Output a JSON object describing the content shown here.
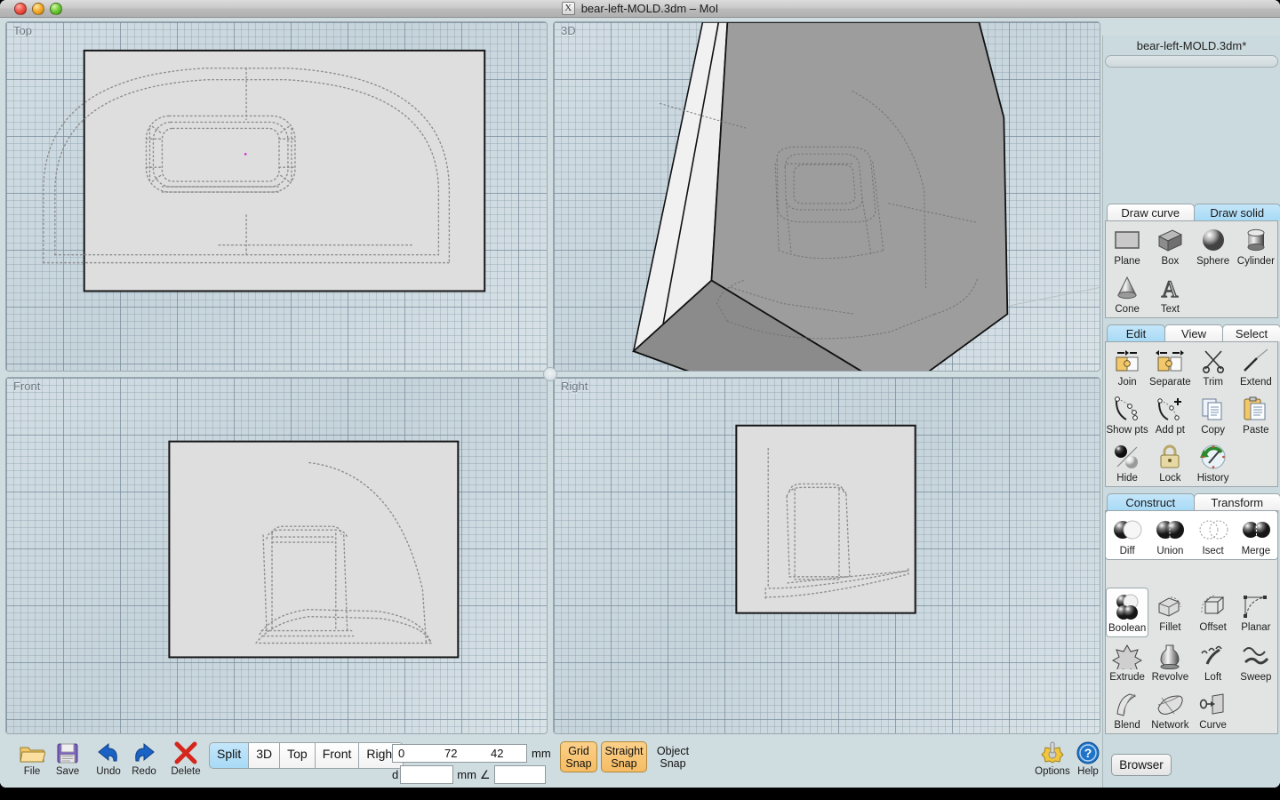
{
  "window": {
    "title": "bear-left-MOLD.3dm – MoI",
    "title_icon": "app-icon",
    "controls": {
      "close": "close",
      "minimize": "minimize",
      "zoom": "zoom"
    }
  },
  "viewports": [
    {
      "name": "top",
      "label": "Top"
    },
    {
      "name": "3d",
      "label": "3D"
    },
    {
      "name": "front",
      "label": "Front"
    },
    {
      "name": "right",
      "label": "Right"
    }
  ],
  "sidepanel": {
    "document_name": "bear-left-MOLD.3dm*",
    "command_placeholder": "",
    "sections": [
      {
        "name": "draw",
        "tabs": [
          {
            "label": "Draw curve",
            "active": false
          },
          {
            "label": "Draw solid",
            "active": true
          }
        ],
        "tools": [
          {
            "label": "Plane",
            "icon": "plane-icon"
          },
          {
            "label": "Box",
            "icon": "box-icon"
          },
          {
            "label": "Sphere",
            "icon": "sphere-icon"
          },
          {
            "label": "Cylinder",
            "icon": "cylinder-icon"
          },
          {
            "label": "Cone",
            "icon": "cone-icon"
          },
          {
            "label": "Text",
            "icon": "text-icon"
          }
        ]
      },
      {
        "name": "edit",
        "tabs": [
          {
            "label": "Edit",
            "active": true
          },
          {
            "label": "View",
            "active": false
          },
          {
            "label": "Select",
            "active": false
          }
        ],
        "tools": [
          {
            "label": "Join",
            "icon": "join-icon"
          },
          {
            "label": "Separate",
            "icon": "separate-icon"
          },
          {
            "label": "Trim",
            "icon": "trim-icon"
          },
          {
            "label": "Extend",
            "icon": "extend-icon"
          },
          {
            "label": "Show pts",
            "icon": "show-points-icon"
          },
          {
            "label": "Add pt",
            "icon": "add-point-icon"
          },
          {
            "label": "Copy",
            "icon": "copy-icon"
          },
          {
            "label": "Paste",
            "icon": "paste-icon"
          },
          {
            "label": "Hide",
            "icon": "hide-icon"
          },
          {
            "label": "Lock",
            "icon": "lock-icon"
          },
          {
            "label": "History",
            "icon": "history-icon"
          }
        ]
      },
      {
        "name": "construct",
        "tabs": [
          {
            "label": "Construct",
            "active": true
          },
          {
            "label": "Transform",
            "active": false
          }
        ],
        "flyout": {
          "name": "boolean-flyout",
          "tools": [
            {
              "label": "Diff",
              "icon": "boolean-difference-icon"
            },
            {
              "label": "Union",
              "icon": "boolean-union-icon"
            },
            {
              "label": "Isect",
              "icon": "boolean-intersect-icon"
            },
            {
              "label": "Merge",
              "icon": "boolean-merge-icon"
            }
          ]
        },
        "tools": [
          {
            "label": "Boolean",
            "icon": "boolean-icon",
            "selected": true
          },
          {
            "label": "Fillet",
            "icon": "fillet-icon"
          },
          {
            "label": "Offset",
            "icon": "offset-icon"
          },
          {
            "label": "Planar",
            "icon": "planar-icon"
          },
          {
            "label": "Extrude",
            "icon": "extrude-icon"
          },
          {
            "label": "Revolve",
            "icon": "revolve-icon"
          },
          {
            "label": "Loft",
            "icon": "loft-icon"
          },
          {
            "label": "Sweep",
            "icon": "sweep-icon"
          },
          {
            "label": "Blend",
            "icon": "blend-icon"
          },
          {
            "label": "Network",
            "icon": "network-icon"
          },
          {
            "label": "Curve",
            "icon": "curve-icon"
          }
        ]
      }
    ]
  },
  "bottombar": {
    "file_tools": [
      {
        "label": "File",
        "icon": "folder-icon"
      },
      {
        "label": "Save",
        "icon": "floppy-disk-icon"
      },
      {
        "label": "Undo",
        "icon": "undo-arrow-icon"
      },
      {
        "label": "Redo",
        "icon": "redo-arrow-icon"
      },
      {
        "label": "Delete",
        "icon": "delete-x-icon"
      }
    ],
    "view_buttons": [
      {
        "label": "Split",
        "active": true
      },
      {
        "label": "3D",
        "active": false
      },
      {
        "label": "Top",
        "active": false
      },
      {
        "label": "Front",
        "active": false
      },
      {
        "label": "Right",
        "active": false
      }
    ],
    "coordinates": {
      "x": "0",
      "y": "72",
      "z": "42",
      "units": "mm",
      "distance_label": "d",
      "distance_value": "",
      "distance_units": "mm",
      "angle_symbol": "∠",
      "angle_value": ""
    },
    "snaps": [
      {
        "label_line1": "Grid",
        "label_line2": "Snap",
        "active": true
      },
      {
        "label_line1": "Straight",
        "label_line2": "Snap",
        "active": true
      },
      {
        "label_line1": "Object",
        "label_line2": "Snap",
        "active": false
      }
    ],
    "right_tools": [
      {
        "label": "Options",
        "icon": "gear-icon"
      },
      {
        "label": "Help",
        "icon": "help-question-icon"
      }
    ],
    "browser_label": "Browser"
  },
  "colors": {
    "panel_bg": "#cbdade",
    "viewport_bg": "#ccd9e0",
    "accent_tab": "#a8daf6",
    "snap_active": "#f6bc63",
    "model_light": "#f0f0f0",
    "model_mid": "#9a9a9a",
    "model_dark": "#8a8a8a",
    "construction_plane": "#dedede"
  }
}
